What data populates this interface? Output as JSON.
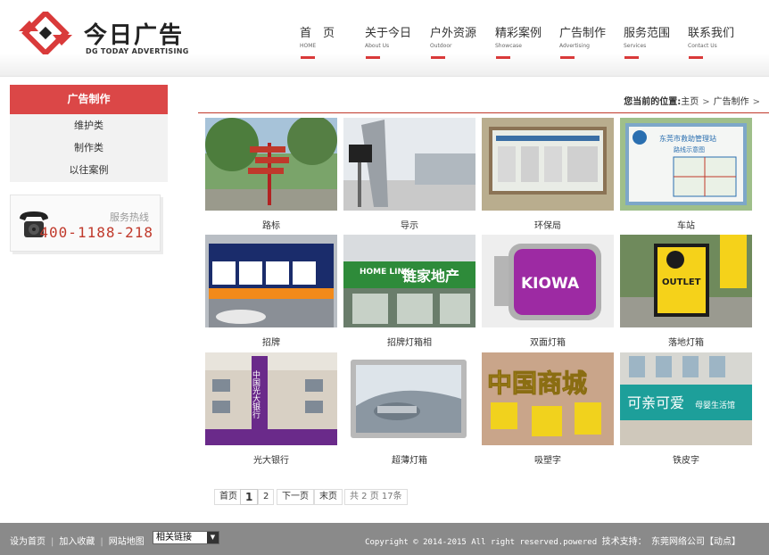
{
  "brand": {
    "name": "今日广告",
    "subtitle": "DG TODAY ADVERTISING",
    "accent": "#db4747"
  },
  "nav": [
    {
      "cn": "首　页",
      "en": "HOME"
    },
    {
      "cn": "关于今日",
      "en": "About Us"
    },
    {
      "cn": "户外资源",
      "en": "Outdoor"
    },
    {
      "cn": "精彩案例",
      "en": "Showcase"
    },
    {
      "cn": "广告制作",
      "en": "Advertising"
    },
    {
      "cn": "服务范围",
      "en": "Services"
    },
    {
      "cn": "联系我们",
      "en": "Contact Us"
    }
  ],
  "sidebar": {
    "title": "广告制作",
    "items": [
      "维护类",
      "制作类",
      "以往案例"
    ]
  },
  "hotline": {
    "label": "服务热线",
    "number": "400-1188-218"
  },
  "breadcrumb": {
    "prefix": "您当前的位置:",
    "home": "主页",
    "current": "广告制作"
  },
  "products": [
    {
      "caption": "路标"
    },
    {
      "caption": "导示"
    },
    {
      "caption": "环保局"
    },
    {
      "caption": "车站"
    },
    {
      "caption": "招牌"
    },
    {
      "caption": "招牌灯箱相"
    },
    {
      "caption": "双面灯箱"
    },
    {
      "caption": "落地灯箱"
    },
    {
      "caption": "光大银行"
    },
    {
      "caption": "超薄灯箱"
    },
    {
      "caption": "吸塑字"
    },
    {
      "caption": "铁皮字"
    }
  ],
  "image_text": {
    "sign_chain": "链家地产",
    "sign_home": "HOME LINK",
    "sign_kiowa": "KIOWA",
    "sign_outlet": "OUTLET",
    "sign_bank": "中国光大银行",
    "sign_shop": "可亲可爱",
    "sign_shop_sub": "母婴生活馆",
    "sign_station": "东莞市救助管理站",
    "sign_station_sub": "路线示意图",
    "sign_chars": "中国商城"
  },
  "pagination": {
    "first": "首页",
    "pages": [
      "1",
      "2"
    ],
    "current": "1",
    "next": "下一页",
    "last": "末页",
    "info": "共 2 页 17条"
  },
  "footer": {
    "links": [
      "设为首页",
      "加入收藏",
      "网站地图"
    ],
    "select_value": "相关链接",
    "copyright": "Copyright © 2014-2015 All right reserved.powered",
    "support_label": "技术支持：",
    "support_company": "东莞网络公司【动点】"
  }
}
